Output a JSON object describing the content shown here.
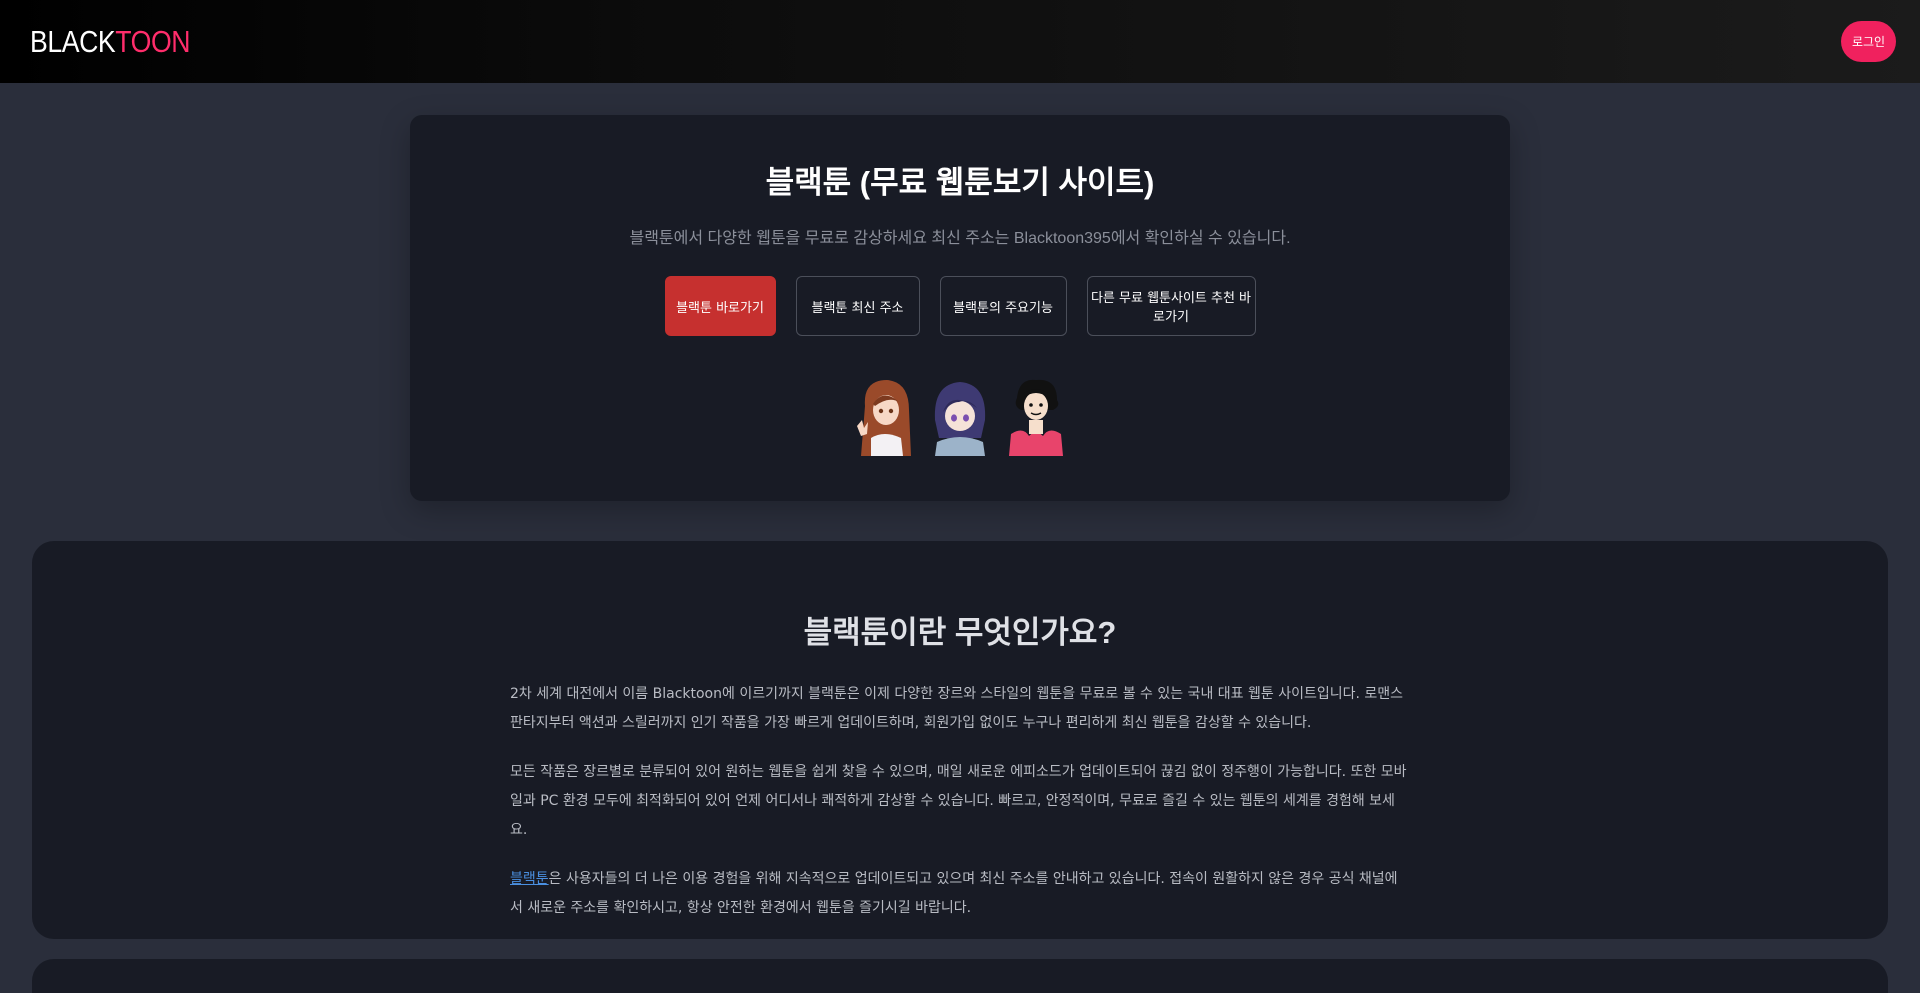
{
  "header": {
    "logo_part1": "BLACK",
    "logo_part2": "TOON",
    "login_label": "로그인"
  },
  "hero": {
    "title": "블랙툰 (무료 웹툰보기 사이트)",
    "subtitle": "블랙툰에서 다양한 웹툰을 무료로 감상하세요 최신 주소는 Blacktoon395에서 확인하실 수 있습니다.",
    "buttons": [
      "블랙툰 바로가기",
      "블랙툰 최신 주소",
      "블랙툰의 주요기능",
      "다른 무료 웹툰사이트 추천 바로가기"
    ]
  },
  "about": {
    "title": "블랙툰이란 무엇인가요?",
    "p1": "2차 세계 대전에서 이름 Blacktoon에 이르기까지 블랙툰은 이제 다양한 장르와 스타일의 웹툰을 무료로 볼 수 있는 국내 대표 웹툰 사이트입니다. 로맨스 판타지부터 액션과 스릴러까지 인기 작품을 가장 빠르게 업데이트하며, 회원가입 없이도 누구나 편리하게 최신 웹툰을 감상할 수 있습니다.",
    "p2": "모든 작품은 장르별로 분류되어 있어 원하는 웹툰을 쉽게 찾을 수 있으며, 매일 새로운 에피소드가 업데이트되어 끊김 없이 정주행이 가능합니다. 또한 모바일과 PC 환경 모두에 최적화되어 있어 언제 어디서나 쾌적하게 감상할 수 있습니다. 빠르고, 안정적이며, 무료로 즐길 수 있는 웹툰의 세계를 경험해 보세요.",
    "link_text": "블랙툰",
    "p3_rest": "은 사용자들의 더 나은 이용 경험을 위해 지속적으로 업데이트되고 있으며 최신 주소를 안내하고 있습니다. 접속이 원활하지 않은 경우 공식 채널에서 새로운 주소를 확인하시고, 항상 안전한 환경에서 웹툰을 즐기시길 바랍니다."
  },
  "colors": {
    "accent": "#f0215e",
    "primary_button": "#c6302f",
    "card_bg": "#181b25",
    "page_bg": "#2a2e3b"
  }
}
